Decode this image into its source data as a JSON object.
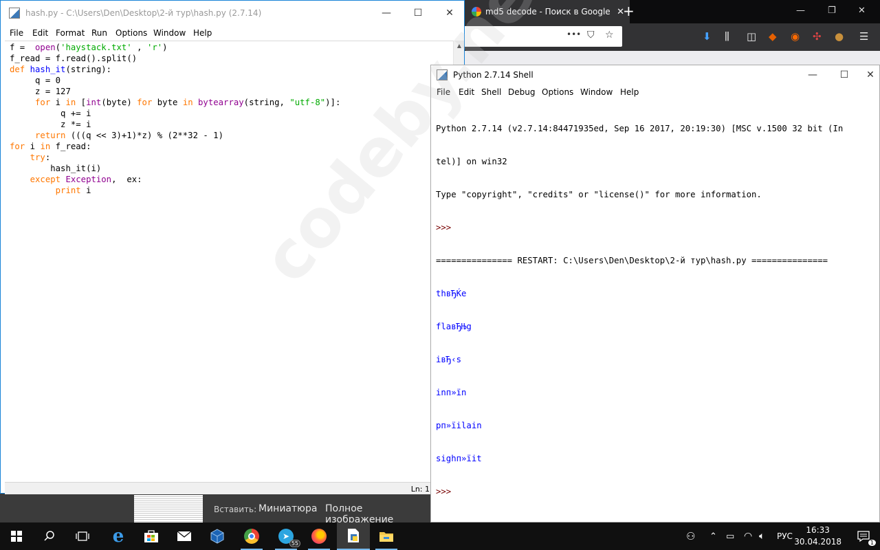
{
  "browser": {
    "tab_title": "md5 decode - Поиск в Google",
    "tab_close": "✕",
    "new_tab": "+",
    "controls": [
      "—",
      "❐",
      "✕"
    ],
    "url_actions": [
      "•••",
      "⛉",
      "☆"
    ]
  },
  "preview": {
    "paste_label": "Вставить:",
    "thumbnail_label": "Миниатюра",
    "full_label": "Полное изображение"
  },
  "editor": {
    "title": "hash.py - C:\\Users\\Den\\Desktop\\2-й тур\\hash.py (2.7.14)",
    "menu": [
      "File",
      "Edit",
      "Format",
      "Run",
      "Options",
      "Window",
      "Help"
    ],
    "status": "Ln: 1",
    "code_lines": [
      "f =  open('haystack.txt' , 'r')",
      "f_read = f.read().split()",
      "def hash_it(string):",
      "     q = 0",
      "     z = 127",
      "     for i in [int(byte) for byte in bytearray(string, \"utf-8\")]:",
      "          q += i",
      "          z *= i",
      "     return (((q << 3)+1)*z) % (2**32 - 1)",
      "for i in f_read:",
      "    try:",
      "        hash_it(i)",
      "    except Exception,  ex:",
      "         print i"
    ]
  },
  "shell": {
    "title": "Python 2.7.14 Shell",
    "menu": [
      "File",
      "Edit",
      "Shell",
      "Debug",
      "Options",
      "Window",
      "Help"
    ],
    "banner": [
      "Python 2.7.14 (v2.7.14:84471935ed, Sep 16 2017, 20:19:30) [MSC v.1500 32 bit (In",
      "tel)] on win32",
      "Type \"copyright\", \"credits\" or \"license()\" for more information."
    ],
    "prompt": ">>>",
    "restart_line": "=============== RESTART: C:\\Users\\Den\\Desktop\\2-й тур\\hash.py ===============",
    "output": [
      "thвЂЌe",
      "flaвЂЊg",
      "iвЂ‹s",
      "inп»їn",
      "pп»їilain",
      "sighп»їit"
    ],
    "final_prompt": ">>>"
  },
  "watermark": "codeby.net",
  "taskbar": {
    "telegram_badge": "55",
    "language": "РУС",
    "time": "16:33",
    "date": "30.04.2018",
    "notification_count": "1"
  },
  "colors": {
    "keyword": "#ff7700",
    "builtin": "#900090",
    "string": "#00aa00",
    "definition": "#0000ff",
    "shell_output": "#0000ff",
    "shell_prompt": "#770000",
    "taskbar_accent": "#76b9ed"
  }
}
